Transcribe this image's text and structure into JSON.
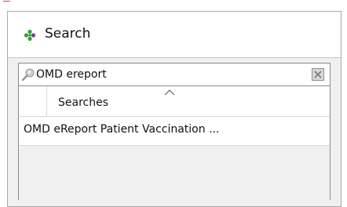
{
  "window": {
    "title": "Search"
  },
  "search": {
    "value": "OMD ereport",
    "placeholder": ""
  },
  "results": {
    "column_header": "Searches",
    "rows": [
      "OMD eReport Patient Vaccination ..."
    ]
  },
  "icons": {
    "title": "search-app-icon",
    "search": "magnifier-icon",
    "clear": "clear-x-icon",
    "sort": "sort-ascending-icon"
  },
  "colors": {
    "icon_green": "#3a9a3a",
    "icon_purple": "#7a3f9a",
    "border": "#8a8a8a",
    "panel_bg": "#f0f0f0"
  }
}
